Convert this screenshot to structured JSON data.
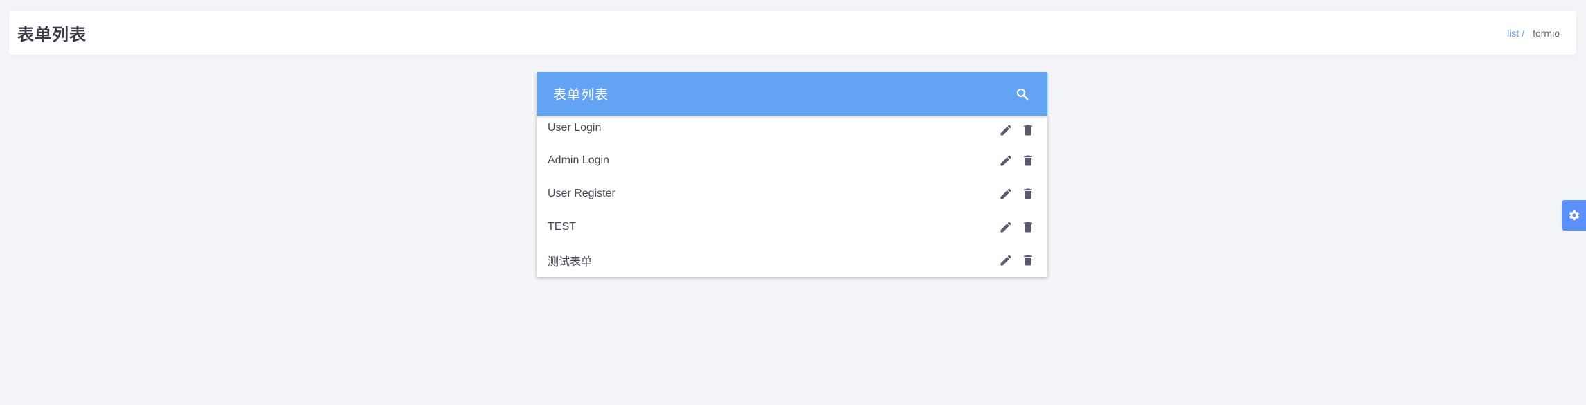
{
  "header": {
    "title": "表单列表",
    "breadcrumb": {
      "link": "list",
      "separator": "/",
      "current": "formio"
    }
  },
  "card": {
    "title": "表单列表",
    "search_icon": "search-icon",
    "items": [
      {
        "label": "User Login"
      },
      {
        "label": "Admin Login"
      },
      {
        "label": "User Register"
      },
      {
        "label": "TEST"
      },
      {
        "label": "测试表单"
      }
    ],
    "edit_icon": "pencil-icon",
    "delete_icon": "trash-icon"
  },
  "settings": {
    "icon": "gear-icon"
  },
  "colors": {
    "background": "#f3f4f8",
    "card_header": "#62a4f3",
    "accent": "#5b8ff9",
    "icon": "#5a5a6e"
  }
}
